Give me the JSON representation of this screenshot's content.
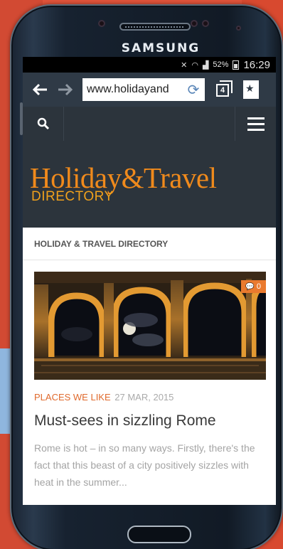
{
  "device": {
    "brand": "SAMSUNG"
  },
  "status_bar": {
    "battery": "52%",
    "time": "16:29"
  },
  "browser": {
    "url": "www.holidayand",
    "tab_count": "4"
  },
  "site": {
    "logo_main": "Holiday&Travel",
    "logo_sub": "DIRECTORY",
    "section_title": "HOLIDAY & TRAVEL DIRECTORY"
  },
  "post": {
    "comment_count": "0",
    "category": "PLACES WE LIKE",
    "date": "27 MAR, 2015",
    "title": "Must-sees in sizzling Rome",
    "excerpt": "Rome is hot – in so many ways. Firstly, there's the fact that this beast of a city positively sizzles with heat in the summer..."
  },
  "colors": {
    "background": "#e0533a",
    "accent": "#f08a1c",
    "category": "#e06a2d",
    "header_bg": "#2c343c"
  }
}
